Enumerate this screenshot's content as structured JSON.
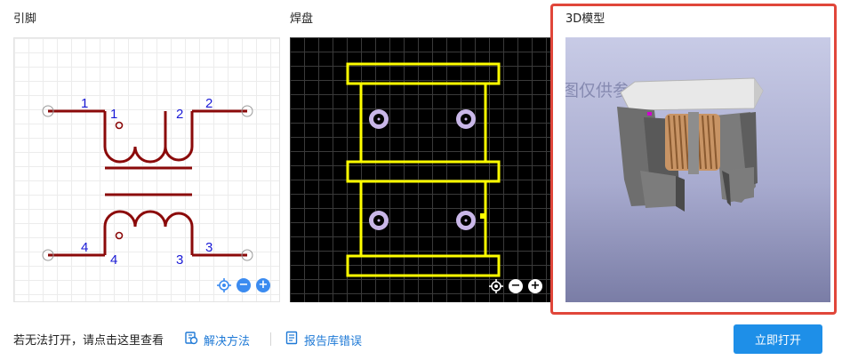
{
  "panels": {
    "pins": {
      "title": "引脚"
    },
    "pads": {
      "title": "焊盘"
    },
    "model": {
      "title": "3D模型"
    }
  },
  "schematic": {
    "pin_labels": [
      "1",
      "2",
      "4",
      "3"
    ],
    "pin_numbers": [
      "1",
      "2",
      "4",
      "3"
    ],
    "line_color": "#8b0a0a",
    "label_color": "#1a1ad6"
  },
  "pcb": {
    "outline_color": "#ffff00",
    "pad_color": "#c9b7e8"
  },
  "model_view": {
    "watermark": "图仅供参考，以实物为准"
  },
  "controls": {
    "zoom_out": "−",
    "zoom_in": "+"
  },
  "footer": {
    "hint": "若无法打开，请点击这里查看",
    "solution_link": "解决方法",
    "report_link": "报告库错误",
    "open_button": "立即打开",
    "accent_color": "#1e8fe8"
  }
}
